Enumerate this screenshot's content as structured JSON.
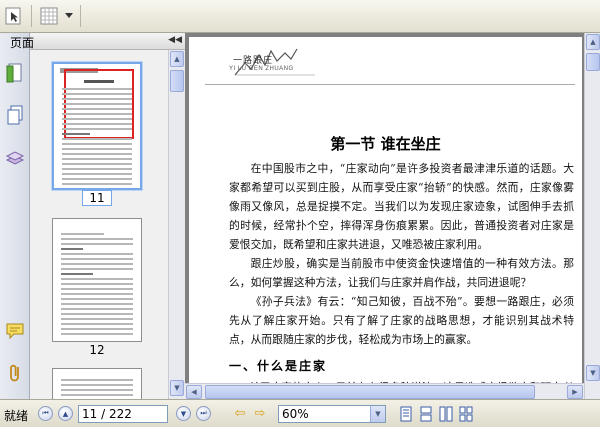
{
  "toolbar": {
    "tools": [
      "select-tool",
      "grid-tool",
      "dropdown"
    ]
  },
  "panel": {
    "title": "页面",
    "thumbnails": [
      {
        "label": "11",
        "selected": true
      },
      {
        "label": "12",
        "selected": false
      }
    ]
  },
  "page": {
    "header_title": "一路跟庄",
    "header_subtitle": "YI LU GEN ZHUANG",
    "section_title": "第一节   谁在坐庄",
    "paragraphs": [
      "在中国股市之中，“庄家动向”是许多投资者最津津乐道的话题。大家都希望可以买到庄股，从而享受庄家“抬轿”的快感。然而，庄家像雾像雨又像风，总是捉摸不定。当我们以为发现庄家迹象，试图伸手去抓的时候，经常扑个空，摔得浑身伤痕累累。因此，普通投资者对庄家是爱恨交加，既希望和庄家共进退，又唯恐被庄家利用。",
      "跟庄炒股，确实是当前股市中使资金快速增值的一种有效方法。那么，如何掌握这种方法，让我们与庄家并肩作战，共同进退呢？",
      "《孙子兵法》有云：“知己知彼，百战不殆”。要想一路跟庄，必须先从了解庄家开始。只有了解了庄家的战略思想，才能识别其战术特点，从而跟随庄家的步伐，轻松成为市场上的赢家。"
    ],
    "subheading": "一、什么是庄家",
    "cut_line": "关于庄家的定义，目前存在很多种说法，这是造成市场散户和研究者"
  },
  "statusbar": {
    "status": "就绪",
    "page_indicator": "11 / 222",
    "zoom": "60%"
  },
  "colors": {
    "selection_border": "#76a7e8",
    "viewer_background": "#808080",
    "nav_arrow": "#d8a01c"
  }
}
